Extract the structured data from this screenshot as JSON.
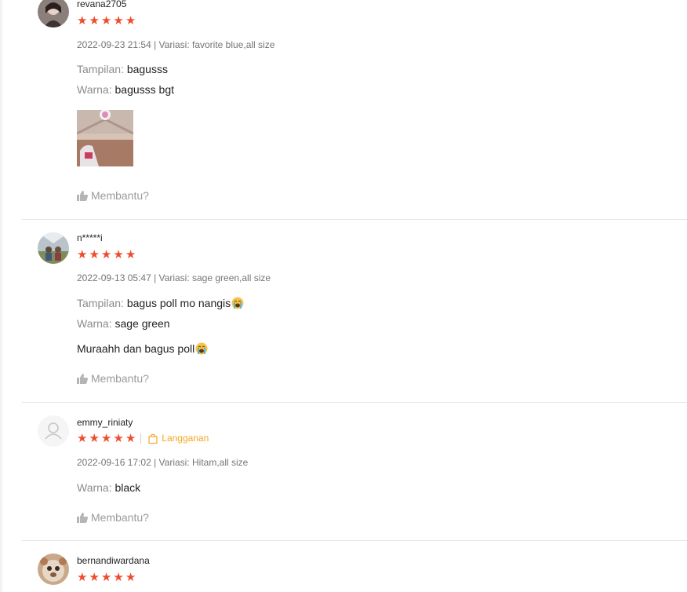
{
  "reviews": [
    {
      "username": "revana2705",
      "rating": 5,
      "meta": "2022-09-23 21:54 | Variasi: favorite blue,all size",
      "attrs": [
        {
          "label": "Tampilan:",
          "value": "bagusss"
        },
        {
          "label": "Warna:",
          "value": "bagusss bgt"
        }
      ],
      "helpful": "Membantu?"
    },
    {
      "username": "n*****i",
      "rating": 5,
      "meta": "2022-09-13 05:47 | Variasi: sage green,all size",
      "attrs": [
        {
          "label": "Tampilan:",
          "value": "bagus poll mo nangis"
        },
        {
          "label": "Warna:",
          "value": "sage green"
        }
      ],
      "comment": "Muraahh dan bagus poll",
      "helpful": "Membantu?"
    },
    {
      "username": "emmy_riniaty",
      "rating": 5,
      "badge": "Langganan",
      "meta": "2022-09-16 17:02 | Variasi: Hitam,all size",
      "attrs": [
        {
          "label": "Warna:",
          "value": "black"
        }
      ],
      "helpful": "Membantu?"
    },
    {
      "username": "bernandiwardana",
      "rating": 5
    }
  ],
  "colors": {
    "star": "#ee4d2d",
    "badge": "#d0011b",
    "label": "#8c8c8c",
    "meta": "#757575"
  },
  "icons": {
    "star": "star-icon",
    "helpful": "thumbs-up-icon",
    "badge": "shopping-bag-icon",
    "emoji": "crying-face-emoji"
  }
}
